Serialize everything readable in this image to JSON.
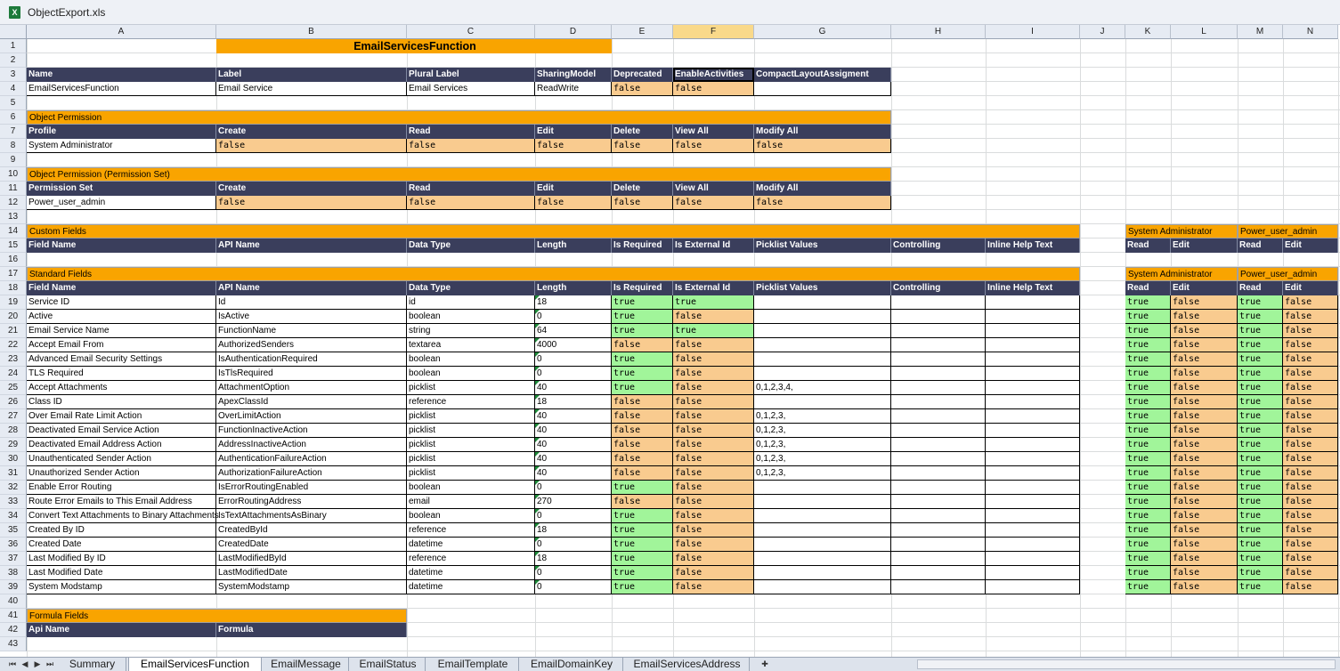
{
  "window": {
    "title": "ObjectExport.xls",
    "app_icon": "excel-icon"
  },
  "columns": [
    "A",
    "B",
    "C",
    "D",
    "E",
    "F",
    "G",
    "H",
    "I",
    "J",
    "K",
    "L",
    "M",
    "N"
  ],
  "selected_column": "F",
  "sheet_title": "EmailServicesFunction",
  "object_header": [
    "Name",
    "Label",
    "Plural Label",
    "SharingModel",
    "Deprecated",
    "EnableActivities",
    "CompactLayoutAssigment"
  ],
  "object_row": [
    "EmailServicesFunction",
    "Email Service",
    "Email Services",
    "ReadWrite",
    "false",
    "false",
    ""
  ],
  "object_permission": {
    "title": "Object Permission",
    "header": [
      "Profile",
      "Create",
      "Read",
      "Edit",
      "Delete",
      "View All",
      "Modify All"
    ],
    "row": [
      "System Administrator",
      "false",
      "false",
      "false",
      "false",
      "false",
      "false"
    ]
  },
  "permission_set": {
    "title": "Object Permission (Permission Set)",
    "header": [
      "Permission Set",
      "Create",
      "Read",
      "Edit",
      "Delete",
      "View All",
      "Modify All"
    ],
    "row": [
      "Power_user_admin",
      "false",
      "false",
      "false",
      "false",
      "false",
      "false"
    ]
  },
  "field_header": [
    "Field Name",
    "API Name",
    "Data Type",
    "Length",
    "Is Required",
    "Is External Id",
    "Picklist Values",
    "Controlling",
    "Inline Help Text"
  ],
  "perm_groups": [
    "System Administrator",
    "Power_user_admin"
  ],
  "perm_header": [
    "Read",
    "Edit",
    "Read",
    "Edit"
  ],
  "custom_fields": {
    "title": "Custom Fields"
  },
  "standard_fields": {
    "title": "Standard Fields",
    "rows": [
      [
        "Service ID",
        "Id",
        "id",
        "18",
        "true",
        "true",
        "",
        "",
        "",
        "true",
        "false",
        "true",
        "false"
      ],
      [
        "Active",
        "IsActive",
        "boolean",
        "0",
        "true",
        "false",
        "",
        "",
        "",
        "true",
        "false",
        "true",
        "false"
      ],
      [
        "Email Service Name",
        "FunctionName",
        "string",
        "64",
        "true",
        "true",
        "",
        "",
        "",
        "true",
        "false",
        "true",
        "false"
      ],
      [
        "Accept Email From",
        "AuthorizedSenders",
        "textarea",
        "4000",
        "false",
        "false",
        "",
        "",
        "",
        "true",
        "false",
        "true",
        "false"
      ],
      [
        "Advanced Email Security Settings",
        "IsAuthenticationRequired",
        "boolean",
        "0",
        "true",
        "false",
        "",
        "",
        "",
        "true",
        "false",
        "true",
        "false"
      ],
      [
        "TLS Required",
        "IsTlsRequired",
        "boolean",
        "0",
        "true",
        "false",
        "",
        "",
        "",
        "true",
        "false",
        "true",
        "false"
      ],
      [
        "Accept Attachments",
        "AttachmentOption",
        "picklist",
        "40",
        "true",
        "false",
        "0,1,2,3,4,",
        "",
        "",
        "true",
        "false",
        "true",
        "false"
      ],
      [
        "Class ID",
        "ApexClassId",
        "reference",
        "18",
        "false",
        "false",
        "",
        "",
        "",
        "true",
        "false",
        "true",
        "false"
      ],
      [
        "Over Email Rate Limit Action",
        "OverLimitAction",
        "picklist",
        "40",
        "false",
        "false",
        "0,1,2,3,",
        "",
        "",
        "true",
        "false",
        "true",
        "false"
      ],
      [
        "Deactivated Email Service Action",
        "FunctionInactiveAction",
        "picklist",
        "40",
        "false",
        "false",
        "0,1,2,3,",
        "",
        "",
        "true",
        "false",
        "true",
        "false"
      ],
      [
        "Deactivated Email Address Action",
        "AddressInactiveAction",
        "picklist",
        "40",
        "false",
        "false",
        "0,1,2,3,",
        "",
        "",
        "true",
        "false",
        "true",
        "false"
      ],
      [
        "Unauthenticated Sender Action",
        "AuthenticationFailureAction",
        "picklist",
        "40",
        "false",
        "false",
        "0,1,2,3,",
        "",
        "",
        "true",
        "false",
        "true",
        "false"
      ],
      [
        "Unauthorized Sender Action",
        "AuthorizationFailureAction",
        "picklist",
        "40",
        "false",
        "false",
        "0,1,2,3,",
        "",
        "",
        "true",
        "false",
        "true",
        "false"
      ],
      [
        "Enable Error Routing",
        "IsErrorRoutingEnabled",
        "boolean",
        "0",
        "true",
        "false",
        "",
        "",
        "",
        "true",
        "false",
        "true",
        "false"
      ],
      [
        "Route Error Emails to This Email Address",
        "ErrorRoutingAddress",
        "email",
        "270",
        "false",
        "false",
        "",
        "",
        "",
        "true",
        "false",
        "true",
        "false"
      ],
      [
        "Convert Text Attachments to Binary Attachments",
        "IsTextAttachmentsAsBinary",
        "boolean",
        "0",
        "true",
        "false",
        "",
        "",
        "",
        "true",
        "false",
        "true",
        "false"
      ],
      [
        "Created By ID",
        "CreatedById",
        "reference",
        "18",
        "true",
        "false",
        "",
        "",
        "",
        "true",
        "false",
        "true",
        "false"
      ],
      [
        "Created Date",
        "CreatedDate",
        "datetime",
        "0",
        "true",
        "false",
        "",
        "",
        "",
        "true",
        "false",
        "true",
        "false"
      ],
      [
        "Last Modified By ID",
        "LastModifiedById",
        "reference",
        "18",
        "true",
        "false",
        "",
        "",
        "",
        "true",
        "false",
        "true",
        "false"
      ],
      [
        "Last Modified Date",
        "LastModifiedDate",
        "datetime",
        "0",
        "true",
        "false",
        "",
        "",
        "",
        "true",
        "false",
        "true",
        "false"
      ],
      [
        "System Modstamp",
        "SystemModstamp",
        "datetime",
        "0",
        "true",
        "false",
        "",
        "",
        "",
        "true",
        "false",
        "true",
        "false"
      ]
    ]
  },
  "formula_fields": {
    "title": "Formula Fields",
    "header": [
      "Api Name",
      "Formula"
    ]
  },
  "tabs": [
    "Summary",
    "EmailServicesFunction",
    "EmailMessage",
    "EmailStatus",
    "EmailTemplate",
    "EmailDomainKey",
    "EmailServicesAddress"
  ],
  "active_tab": "EmailServicesFunction",
  "tab_nav_icons": [
    "first-sheet-icon",
    "prev-sheet-icon",
    "next-sheet-icon",
    "last-sheet-icon",
    "insert-sheet-icon"
  ]
}
